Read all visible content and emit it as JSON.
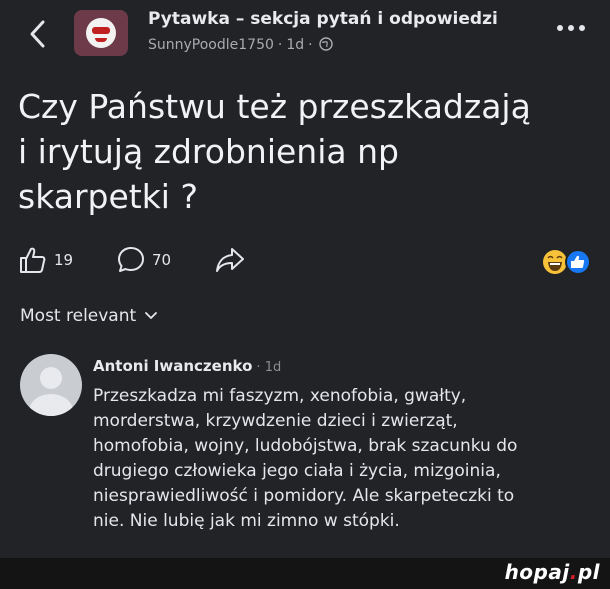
{
  "header": {
    "group_name": "Pytawka – sekcja pytań i odpowiedzi",
    "author": "SunnyPoodle1750",
    "separator": "·",
    "time": "1d",
    "separator2": "·"
  },
  "post": {
    "title_lines": [
      "Czy Państwu też przeszkadzają",
      "i irytują zdrobnienia np",
      "skarpetki ?"
    ],
    "likes": "19",
    "comments": "70"
  },
  "sort": {
    "label": "Most relevant"
  },
  "comment": {
    "author": "Antoni Iwanczenko",
    "separator": "·",
    "time": "1d",
    "lines": [
      "Przeszkadza mi faszyzm, xenofobia, gwałty,",
      "morderstwa, krzywdzenie dzieci i zwierząt,",
      "homofobia, wojny, ludobójstwa, brak szacunku do",
      "drugiego człowieka jego ciała i życia, mizgoinia,",
      "niesprawiedliwość i pomidory. Ale skarpeteczki to",
      "nie. Nie lubię jak mi zimno w stópki."
    ]
  },
  "watermark": {
    "main": "hopaj",
    "dot": ".",
    "tld": "pl"
  },
  "icons": {
    "back": "chevron-left-icon",
    "more": "more-horizontal-icon",
    "globe": "globe-icon",
    "like": "thumbs-up-icon",
    "comment": "comment-bubble-icon",
    "share": "share-arrow-icon",
    "reactions": "reaction-summary-icon",
    "sort": "chevron-down-icon"
  },
  "colors": {
    "background": "#222326",
    "text": "#e4e6eb",
    "muted": "#a8abaf",
    "like_blue": "#1877f2",
    "haha_yellow": "#f7c23a"
  }
}
